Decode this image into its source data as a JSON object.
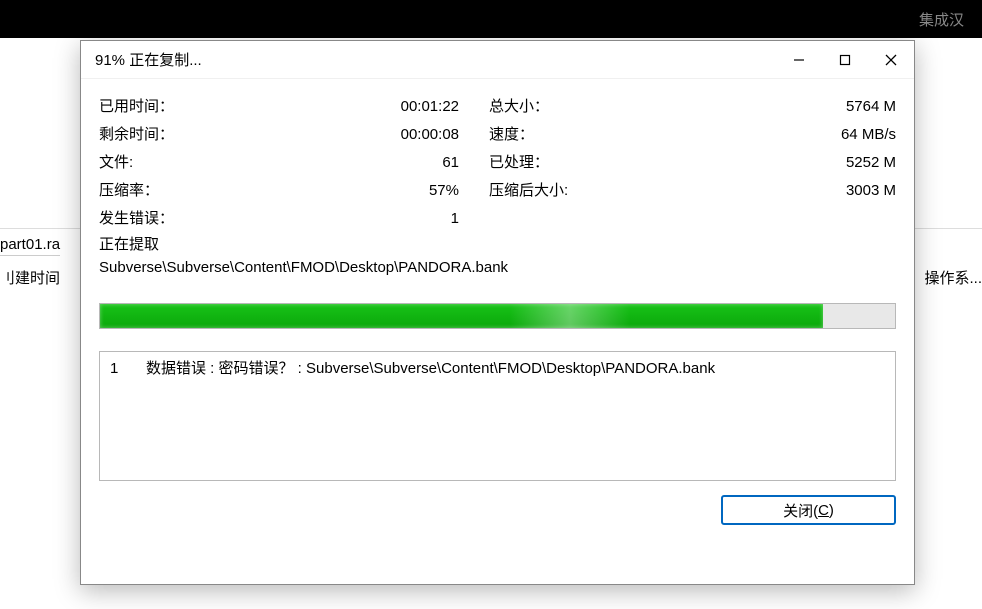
{
  "background": {
    "toolbar_right": "集成汉",
    "left_file": "part01.ra",
    "create_time": "刂建时间",
    "right_label": "操作系..."
  },
  "titlebar": {
    "title": "91% 正在复制..."
  },
  "stats": {
    "elapsed_label": "已用时间：",
    "elapsed_value": "00:01:22",
    "remaining_label": "剩余时间：",
    "remaining_value": "00:00:08",
    "files_label": "文件:",
    "files_value": "61",
    "ratio_label": "压缩率：",
    "ratio_value": "57%",
    "errors_label": "发生错误：",
    "errors_value": "1",
    "total_label": "总大小：",
    "total_value": "5764 M",
    "speed_label": "速度：",
    "speed_value": "64 MB/s",
    "processed_label": "已处理：",
    "processed_value": "5252 M",
    "compressed_label": "压缩后大小:",
    "compressed_value": "3003 M"
  },
  "status_line": "正在提取",
  "current_path": "Subverse\\Subverse\\Content\\FMOD\\Desktop\\PANDORA.bank",
  "progress": {
    "percent": 91
  },
  "errors": [
    {
      "num": "1",
      "msg": "数据错误 : 密码错误？ : Subverse\\Subverse\\Content\\FMOD\\Desktop\\PANDORA.bank"
    }
  ],
  "close_button": {
    "label_pre": "关闭(",
    "accel": "C",
    "label_post": ")"
  }
}
